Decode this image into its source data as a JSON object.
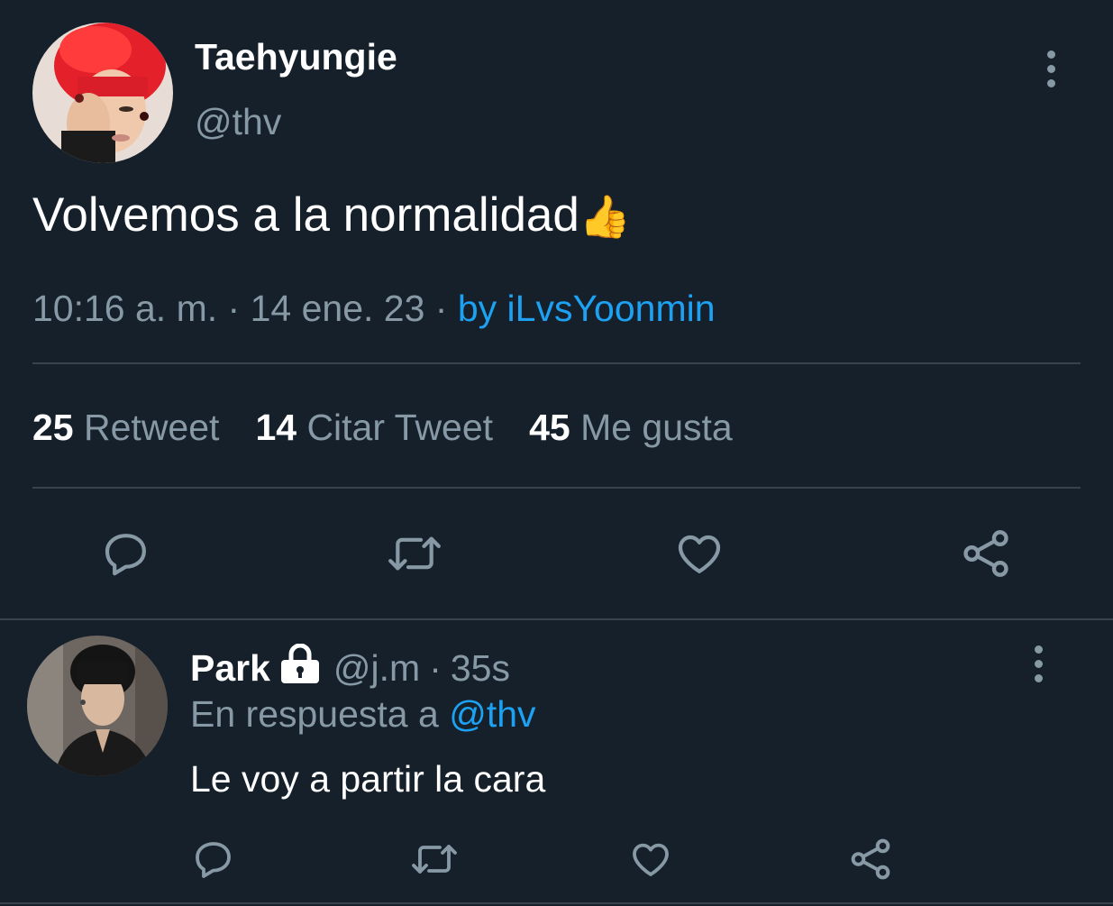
{
  "tweet": {
    "display_name": "Taehyungie",
    "handle": "@thv",
    "text": "Volvemos a la normalidad",
    "emoji": "👍",
    "time": "10:16 a. m.",
    "sep1": "·",
    "date": "14 ene. 23",
    "sep2": "·",
    "source": "by iLvsYoonmin",
    "stats": [
      {
        "count": "25",
        "label": "Retweet"
      },
      {
        "count": "14",
        "label": "Citar Tweet"
      },
      {
        "count": "45",
        "label": "Me gusta"
      }
    ]
  },
  "reply": {
    "display_name": "Park",
    "handle": "@j.m",
    "sep": "·",
    "time": "35s",
    "reply_to_prefix": "En respuesta a",
    "reply_to_handle": "@thv",
    "text": "Le voy a partir la cara"
  },
  "icons": {
    "more": "more-vertical-icon",
    "reply": "reply-icon",
    "retweet": "retweet-icon",
    "like": "heart-icon",
    "share": "share-icon",
    "lock": "lock-icon"
  },
  "colors": {
    "background": "#15202b",
    "divider": "#38444d",
    "muted_text": "#8899a6",
    "link": "#1da1f2",
    "text": "#ffffff"
  }
}
